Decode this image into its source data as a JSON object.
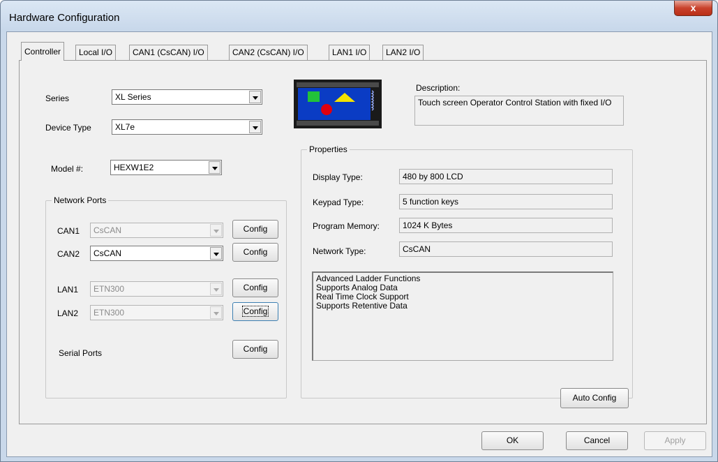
{
  "window": {
    "title": "Hardware Configuration",
    "close_glyph": "x"
  },
  "tabs": [
    {
      "label": "Controller"
    },
    {
      "label": "Local I/O"
    },
    {
      "label": "CAN1 (CsCAN) I/O"
    },
    {
      "label": "CAN2 (CsCAN) I/O"
    },
    {
      "label": "LAN1 I/O"
    },
    {
      "label": "LAN2 I/O"
    }
  ],
  "controller": {
    "series_label": "Series",
    "series_value": "XL Series",
    "device_type_label": "Device Type",
    "device_type_value": "XL7e",
    "model_label": "Model #:",
    "model_value": "HEXW1E2"
  },
  "network_ports": {
    "title": "Network Ports",
    "can1": {
      "label": "CAN1",
      "value": "CsCAN",
      "button": "Config"
    },
    "can2": {
      "label": "CAN2",
      "value": "CsCAN",
      "button": "Config"
    },
    "lan1": {
      "label": "LAN1",
      "value": "ETN300",
      "button": "Config"
    },
    "lan2": {
      "label": "LAN2",
      "value": "ETN300",
      "button": "Config"
    },
    "serial": {
      "label": "Serial Ports",
      "button": "Config"
    }
  },
  "description": {
    "label": "Description:",
    "text": "Touch screen Operator Control Station with fixed I/O"
  },
  "properties": {
    "title": "Properties",
    "display_type_label": "Display Type:",
    "display_type_value": "480 by 800 LCD",
    "keypad_type_label": "Keypad Type:",
    "keypad_type_value": "5 function keys",
    "program_memory_label": "Program Memory:",
    "program_memory_value": "1024 K Bytes",
    "network_type_label": "Network Type:",
    "network_type_value": "CsCAN",
    "features": [
      "Advanced Ladder Functions",
      "Supports Analog Data",
      "Real Time Clock Support",
      "Supports Retentive Data"
    ]
  },
  "buttons": {
    "auto_config": "Auto Config",
    "ok": "OK",
    "cancel": "Cancel",
    "apply": "Apply"
  },
  "device_image": {
    "icon": "device-illustration-icon",
    "colors": {
      "frame": "#1a1a1a",
      "screen": "#0a3cc4",
      "green": "#22c23a",
      "yellow": "#f4e200",
      "red": "#e00010"
    }
  }
}
